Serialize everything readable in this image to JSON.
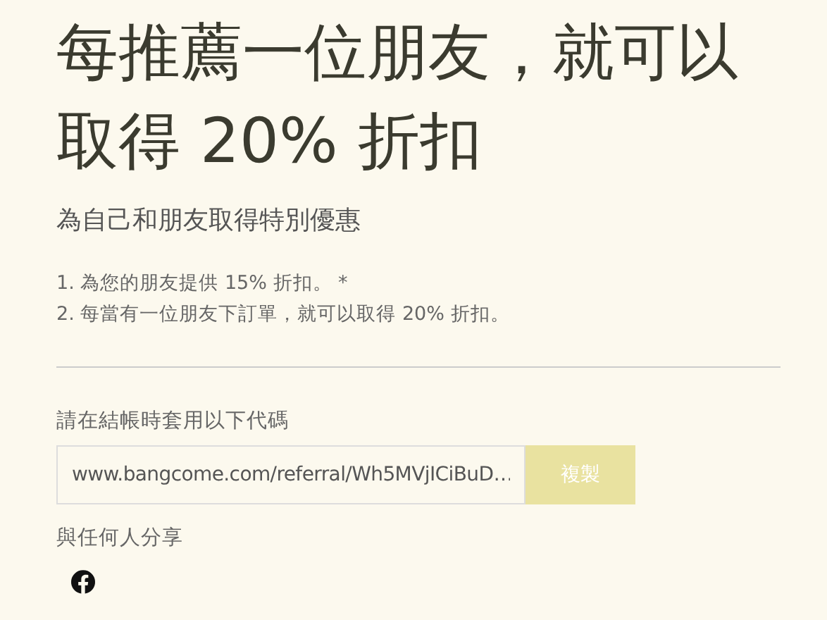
{
  "title": "每推薦一位朋友，就可以取得 20% 折扣",
  "subtitle": "為自己和朋友取得特別優惠",
  "benefits": [
    "1. 為您的朋友提供 15% 折扣。 *",
    "2. 每當有一位朋友下訂單，就可以取得 20% 折扣。"
  ],
  "code_label": "請在結帳時套用以下代碼",
  "referral_link": {
    "value": "www.bangcome.com/referral/Wh5MVjICiBuD…"
  },
  "copy_button": {
    "label": "複製",
    "disabled": true
  },
  "share_label": "與任何人分享",
  "share_icons": [
    {
      "kind": "facebook"
    }
  ]
}
